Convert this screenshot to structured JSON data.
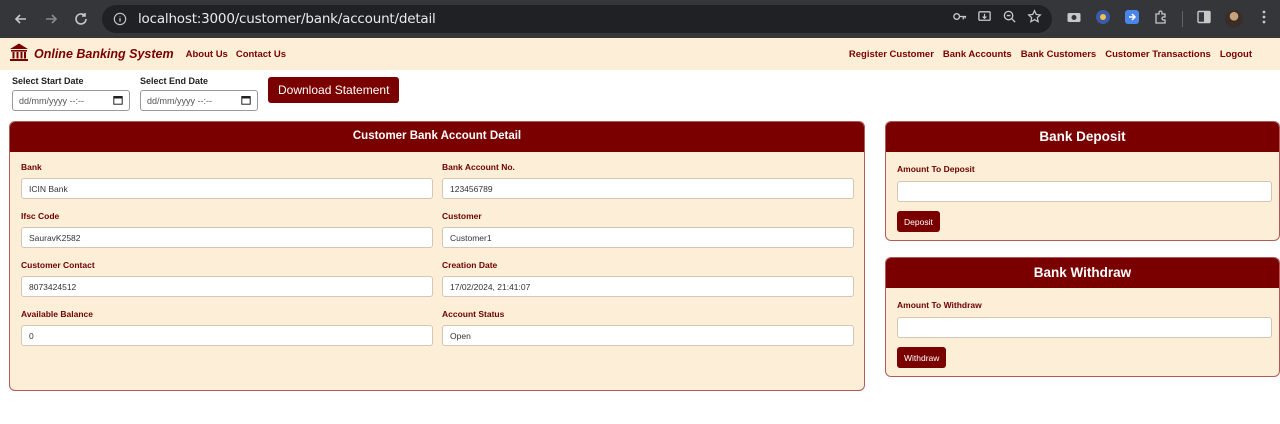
{
  "browser": {
    "url": "localhost:3000/customer/bank/account/detail",
    "icons": [
      "back-icon",
      "forward-icon",
      "reload-icon",
      "info-icon",
      "key-icon",
      "install-icon",
      "zoom-icon",
      "star-icon",
      "camera-icon",
      "extension-icon",
      "puzzle-icon",
      "sidepanel-icon",
      "menu-icon"
    ]
  },
  "navbar": {
    "brand": "Online Banking System",
    "left_links": [
      "About Us",
      "Contact Us"
    ],
    "right_links": [
      "Register Customer",
      "Bank Accounts",
      "Bank Customers",
      "Customer Transactions",
      "Logout"
    ]
  },
  "statement": {
    "start_label": "Select Start Date",
    "end_label": "Select End Date",
    "date_placeholder": "dd/mm/yyyy --:--",
    "download_label": "Download Statement"
  },
  "detail": {
    "title": "Customer Bank Account Detail",
    "fields": [
      {
        "label": "Bank",
        "value": "ICIN Bank"
      },
      {
        "label": "Bank Account No.",
        "value": "123456789"
      },
      {
        "label": "Ifsc Code",
        "value": "SauravK2582"
      },
      {
        "label": "Customer",
        "value": "Customer1"
      },
      {
        "label": "Customer Contact",
        "value": "8073424512"
      },
      {
        "label": "Creation Date",
        "value": "17/02/2024, 21:41:07"
      },
      {
        "label": "Available Balance",
        "value": "0"
      },
      {
        "label": "Account Status",
        "value": "Open"
      }
    ]
  },
  "deposit": {
    "title": "Bank Deposit",
    "label": "Amount To Deposit",
    "value": "",
    "button": "Deposit"
  },
  "withdraw": {
    "title": "Bank Withdraw",
    "label": "Amount To Withdraw",
    "value": "",
    "button": "Withdraw"
  },
  "colors": {
    "primary": "#7a0000",
    "panel_bg": "#fdefd7",
    "chrome_bg": "#35363a"
  }
}
